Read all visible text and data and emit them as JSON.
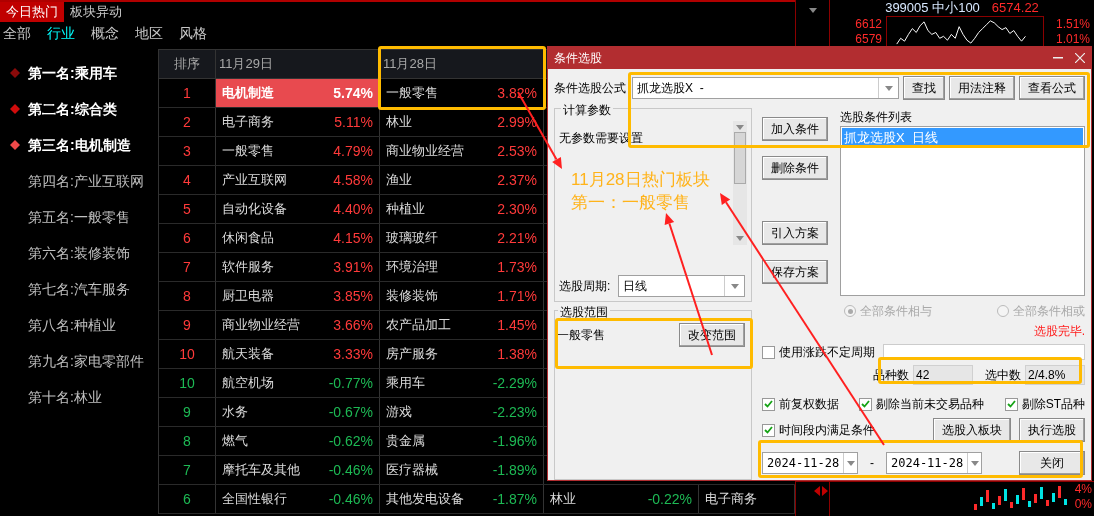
{
  "tabs": [
    {
      "label": "今日热门",
      "selected": true
    },
    {
      "label": "板块异动",
      "selected": false
    }
  ],
  "categories": [
    {
      "label": "全部",
      "selected": false
    },
    {
      "label": "行业",
      "selected": true
    },
    {
      "label": "概念",
      "selected": false
    },
    {
      "label": "地区",
      "selected": false
    },
    {
      "label": "风格",
      "selected": false
    }
  ],
  "ranking": [
    {
      "label": "第一名:乘用车",
      "kind": "top",
      "color": "#8b0a0a"
    },
    {
      "label": "第二名:综合类",
      "kind": "top",
      "color": "#d00c0c"
    },
    {
      "label": "第三名:电机制造",
      "kind": "top",
      "color": "#f04a4a"
    },
    {
      "label": "第四名:产业互联网",
      "kind": "plain"
    },
    {
      "label": "第五名:一般零售",
      "kind": "plain"
    },
    {
      "label": "第六名:装修装饰",
      "kind": "plain"
    },
    {
      "label": "第七名:汽车服务",
      "kind": "plain"
    },
    {
      "label": "第八名:种植业",
      "kind": "plain"
    },
    {
      "label": "第九名:家电零部件",
      "kind": "plain"
    },
    {
      "label": "第十名:林业",
      "kind": "plain"
    }
  ],
  "table": {
    "rank_header": "排序",
    "columns": [
      "11月29日",
      "11月28日"
    ],
    "rows": [
      {
        "rank": "1",
        "up": true,
        "cells": [
          {
            "name": "电机制造",
            "pct": "5.74%",
            "selected": true
          },
          {
            "name": "一般零售",
            "pct": "3.82%",
            "selected": false
          }
        ]
      },
      {
        "rank": "2",
        "up": true,
        "cells": [
          {
            "name": "电子商务",
            "pct": "5.11%",
            "selected": false
          },
          {
            "name": "林业",
            "pct": "2.99%",
            "selected": false
          }
        ]
      },
      {
        "rank": "3",
        "up": true,
        "cells": [
          {
            "name": "一般零售",
            "pct": "4.79%",
            "selected": false
          },
          {
            "name": "商业物业经营",
            "pct": "2.53%",
            "selected": false
          }
        ]
      },
      {
        "rank": "4",
        "up": true,
        "cells": [
          {
            "name": "产业互联网",
            "pct": "4.58%",
            "selected": false
          },
          {
            "name": "渔业",
            "pct": "2.37%",
            "selected": false
          }
        ]
      },
      {
        "rank": "5",
        "up": true,
        "cells": [
          {
            "name": "自动化设备",
            "pct": "4.40%",
            "selected": false
          },
          {
            "name": "种植业",
            "pct": "2.30%",
            "selected": false
          }
        ]
      },
      {
        "rank": "6",
        "up": true,
        "cells": [
          {
            "name": "休闲食品",
            "pct": "4.15%",
            "selected": false
          },
          {
            "name": "玻璃玻纤",
            "pct": "2.21%",
            "selected": false
          }
        ]
      },
      {
        "rank": "7",
        "up": true,
        "cells": [
          {
            "name": "软件服务",
            "pct": "3.91%",
            "selected": false
          },
          {
            "name": "环境治理",
            "pct": "1.73%",
            "selected": false
          }
        ]
      },
      {
        "rank": "8",
        "up": true,
        "cells": [
          {
            "name": "厨卫电器",
            "pct": "3.85%",
            "selected": false
          },
          {
            "name": "装修装饰",
            "pct": "1.71%",
            "selected": false
          }
        ]
      },
      {
        "rank": "9",
        "up": true,
        "cells": [
          {
            "name": "商业物业经营",
            "pct": "3.66%",
            "selected": false
          },
          {
            "name": "农产品加工",
            "pct": "1.45%",
            "selected": false
          }
        ]
      },
      {
        "rank": "10",
        "up": true,
        "cells": [
          {
            "name": "航天装备",
            "pct": "3.33%",
            "selected": false
          },
          {
            "name": "房产服务",
            "pct": "1.38%",
            "selected": false
          }
        ]
      },
      {
        "rank": "10",
        "up": false,
        "cells": [
          {
            "name": "航空机场",
            "pct": "-0.77%",
            "selected": false
          },
          {
            "name": "乘用车",
            "pct": "-2.29%",
            "selected": false
          }
        ]
      },
      {
        "rank": "9",
        "up": false,
        "cells": [
          {
            "name": "水务",
            "pct": "-0.67%",
            "selected": false
          },
          {
            "name": "游戏",
            "pct": "-2.23%",
            "selected": false
          }
        ]
      },
      {
        "rank": "8",
        "up": false,
        "cells": [
          {
            "name": "燃气",
            "pct": "-0.62%",
            "selected": false
          },
          {
            "name": "贵金属",
            "pct": "-1.96%",
            "selected": false
          }
        ]
      },
      {
        "rank": "7",
        "up": false,
        "cells": [
          {
            "name": "摩托车及其他",
            "pct": "-0.46%",
            "selected": false
          },
          {
            "name": "医疗器械",
            "pct": "-1.89%",
            "selected": false
          }
        ]
      },
      {
        "rank": "6",
        "up": false,
        "cells": [
          {
            "name": "全国性银行",
            "pct": "-0.46%",
            "selected": false
          },
          {
            "name": "其他发电设备",
            "pct": "-1.87%",
            "selected": false
          },
          {
            "name": "林业",
            "pct": "-0.22%",
            "selected": false
          },
          {
            "name": "电子商务",
            "selected": false
          }
        ]
      }
    ]
  },
  "index_chart": {
    "code": "399005 中小100",
    "value": "6574.22",
    "left_labels": [
      "6612",
      "6579"
    ],
    "right_labels": [
      "1.51%",
      "1.01%"
    ]
  },
  "lower_chart": {
    "right_labels": [
      "4%",
      "0%"
    ]
  },
  "dialog": {
    "title": "条件选股",
    "formula": {
      "label": "条件选股公式",
      "value": "抓龙选股X  -"
    },
    "top_buttons": [
      "查找",
      "用法注释",
      "查看公式"
    ],
    "params": {
      "title": "计算参数",
      "text": "无参数需要设置"
    },
    "period": {
      "label": "选股周期:",
      "value": "日线"
    },
    "scope": {
      "title": "选股范围",
      "value": "一般零售",
      "button": "改变范围"
    },
    "side_buttons": [
      "加入条件",
      "删除条件",
      "引入方案",
      "保存方案"
    ],
    "conditions": {
      "title": "选股条件列表",
      "items": [
        {
          "label": "抓龙选股X  日线",
          "selected": true
        }
      ]
    },
    "logic": {
      "disabled": true,
      "options": [
        {
          "label": "全部条件相与",
          "selected": true
        },
        {
          "label": "全部条件相或",
          "selected": false
        }
      ]
    },
    "status": "选股完毕.",
    "uncertain": {
      "label": "使用涨跌不定周期",
      "checked": false
    },
    "counts": [
      {
        "label": "品种数",
        "value": "42"
      },
      {
        "label": "选中数",
        "value": "2/4.8%"
      }
    ],
    "options": [
      {
        "label": "前复权数据",
        "checked": true
      },
      {
        "label": "剔除当前未交易品种",
        "checked": true
      },
      {
        "label": "剔除ST品种",
        "checked": true
      }
    ],
    "time_filter": {
      "label": "时间段内满足条件",
      "checked": true
    },
    "action_buttons": [
      "选股入板块",
      "执行选股"
    ],
    "date_from": "2024-11-28",
    "date_separator": "-",
    "date_to": "2024-11-28",
    "close_button": "关闭"
  },
  "annotation": {
    "lines": [
      "11月28日热门板块",
      "第一：一般零售"
    ]
  }
}
